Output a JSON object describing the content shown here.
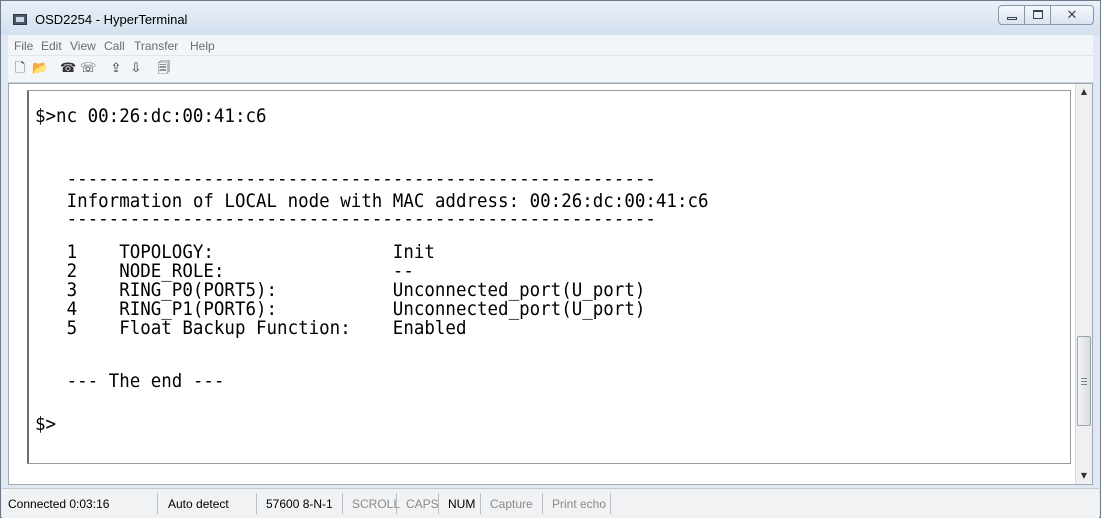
{
  "window": {
    "title": "OSD2254 - HyperTerminal",
    "close_glyph": "✕"
  },
  "menu": [
    "File",
    "Edit",
    "View",
    "Call",
    "Transfer",
    "Help"
  ],
  "toolbar": {
    "icons": [
      "new-document-icon",
      "open-folder-icon",
      "call-icon",
      "disconnect-icon",
      "send-icon",
      "receive-icon",
      "properties-icon"
    ],
    "glyphs": [
      "🗋",
      "📂",
      "☎",
      "☏",
      "⇪",
      "⇩",
      "🗐"
    ]
  },
  "terminal": {
    "lines": [
      "$>nc 00:26:dc:00:41:c6",
      "",
      "   --------------------------------------------------------",
      "   Information of LOCAL node with MAC address: 00:26:dc:00:41:c6",
      "   --------------------------------------------------------",
      "   1    TOPOLOGY:                 Init",
      "   2    NODE_ROLE:                --",
      "   3    RING_P0(PORT5):           Unconnected_port(U_port)",
      "   4    RING_P1(PORT6):           Unconnected_port(U_port)",
      "   5    Float Backup Function:    Enabled",
      "",
      "   --- The end ---",
      "",
      "$>"
    ]
  },
  "scrollbar": {
    "up_arrow": "▲",
    "down_arrow": "▼",
    "position": 0.85
  },
  "status": {
    "connected": "Connected 0:03:16",
    "detect": "Auto detect",
    "settings": "57600 8-N-1",
    "scroll": "SCROLL",
    "caps": "CAPS",
    "num": "NUM",
    "capture": "Capture",
    "print_echo": "Print echo"
  }
}
